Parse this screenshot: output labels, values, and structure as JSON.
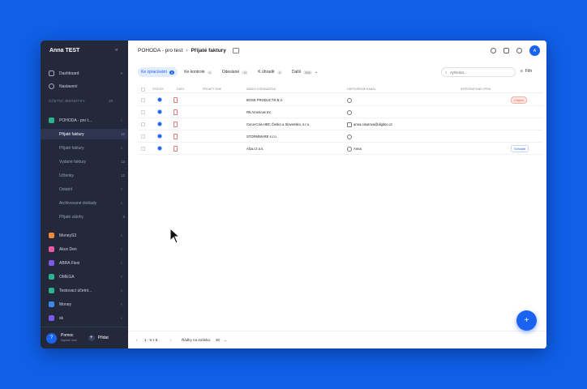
{
  "org_name": "Anna TEST",
  "sidebar": {
    "dashboard": "Dashboard",
    "settings": "Nastavení",
    "section": "ÚČETNÍ JEDNOTKY",
    "section_count": "19",
    "items": [
      {
        "label": "POHODA - pro t...",
        "num": "",
        "color": "#2cb28c"
      },
      {
        "label": "Přijaté faktury",
        "num": "10",
        "color": ""
      },
      {
        "label": "Přijaté faktury",
        "num": "",
        "color": ""
      },
      {
        "label": "Vydané faktury",
        "num": "13",
        "color": ""
      },
      {
        "label": "Účtenky",
        "num": "12",
        "color": ""
      },
      {
        "label": "Ostatní",
        "num": "",
        "color": ""
      },
      {
        "label": "Archivované doklady",
        "num": "",
        "color": ""
      },
      {
        "label": "Přijaté zálohy",
        "num": "2",
        "color": ""
      },
      {
        "label": "MoneyS3",
        "num": "",
        "color": "#f08a3a"
      },
      {
        "label": "Akce Den",
        "num": "",
        "color": "#e85aa8"
      },
      {
        "label": "ABRA Flexi",
        "num": "",
        "color": "#7a5ae8"
      },
      {
        "label": "OMEGA",
        "num": "",
        "color": "#2cb28c"
      },
      {
        "label": "Testovací účetní...",
        "num": "",
        "color": "#2cb28c"
      },
      {
        "label": "Money",
        "num": "",
        "color": "#3a8ae8"
      },
      {
        "label": "sk",
        "num": "",
        "color": "#7a5ae8"
      }
    ],
    "help": "Pomoc",
    "help_sub": "Napište nám",
    "add": "Přidat"
  },
  "breadcrumb": {
    "root": "POHODA - pro test",
    "current": "Přijaté faktury"
  },
  "tabs": [
    {
      "label": "Ke zpracování",
      "count": "5"
    },
    {
      "label": "Ke kontrole",
      "count": "0"
    },
    {
      "label": "Odeslané",
      "count": "11"
    },
    {
      "label": "K úhradě",
      "count": "4"
    },
    {
      "label": "Další",
      "count": "555"
    }
  ],
  "search": {
    "placeholder": "Vyhledat..."
  },
  "filter_label": "Filtr",
  "columns": {
    "status": "STATUS",
    "date": "DATA",
    "received": "PŘIJATÝ DNE",
    "supplier": "NÁZEV DODAVATELE",
    "responsible": "ODPOVĚDNÉ KANÁL",
    "integration": "INTEGRATIONS ZPRÁ"
  },
  "rows": [
    {
      "supplier": "BOSE PRODUCTS B.V.",
      "responsible": "",
      "tag": "Chyba"
    },
    {
      "supplier": "R5 Americas Inc",
      "responsible": "",
      "tag": ""
    },
    {
      "supplier": "Coca-Cola HBC Česko a Slovensko, s.r.o.",
      "responsible": "anna.cisarova@digitoo.cz",
      "tag": ""
    },
    {
      "supplier": "STORMWARE s.r.o.",
      "responsible": "",
      "tag": ""
    },
    {
      "supplier": "Alza.cz a.s.",
      "responsible": "Anna",
      "tag": "Schválit"
    }
  ],
  "pagination": {
    "range": "1 - 5 z 5",
    "per_page_label": "Řádky na stránku:",
    "per_page": "30"
  }
}
